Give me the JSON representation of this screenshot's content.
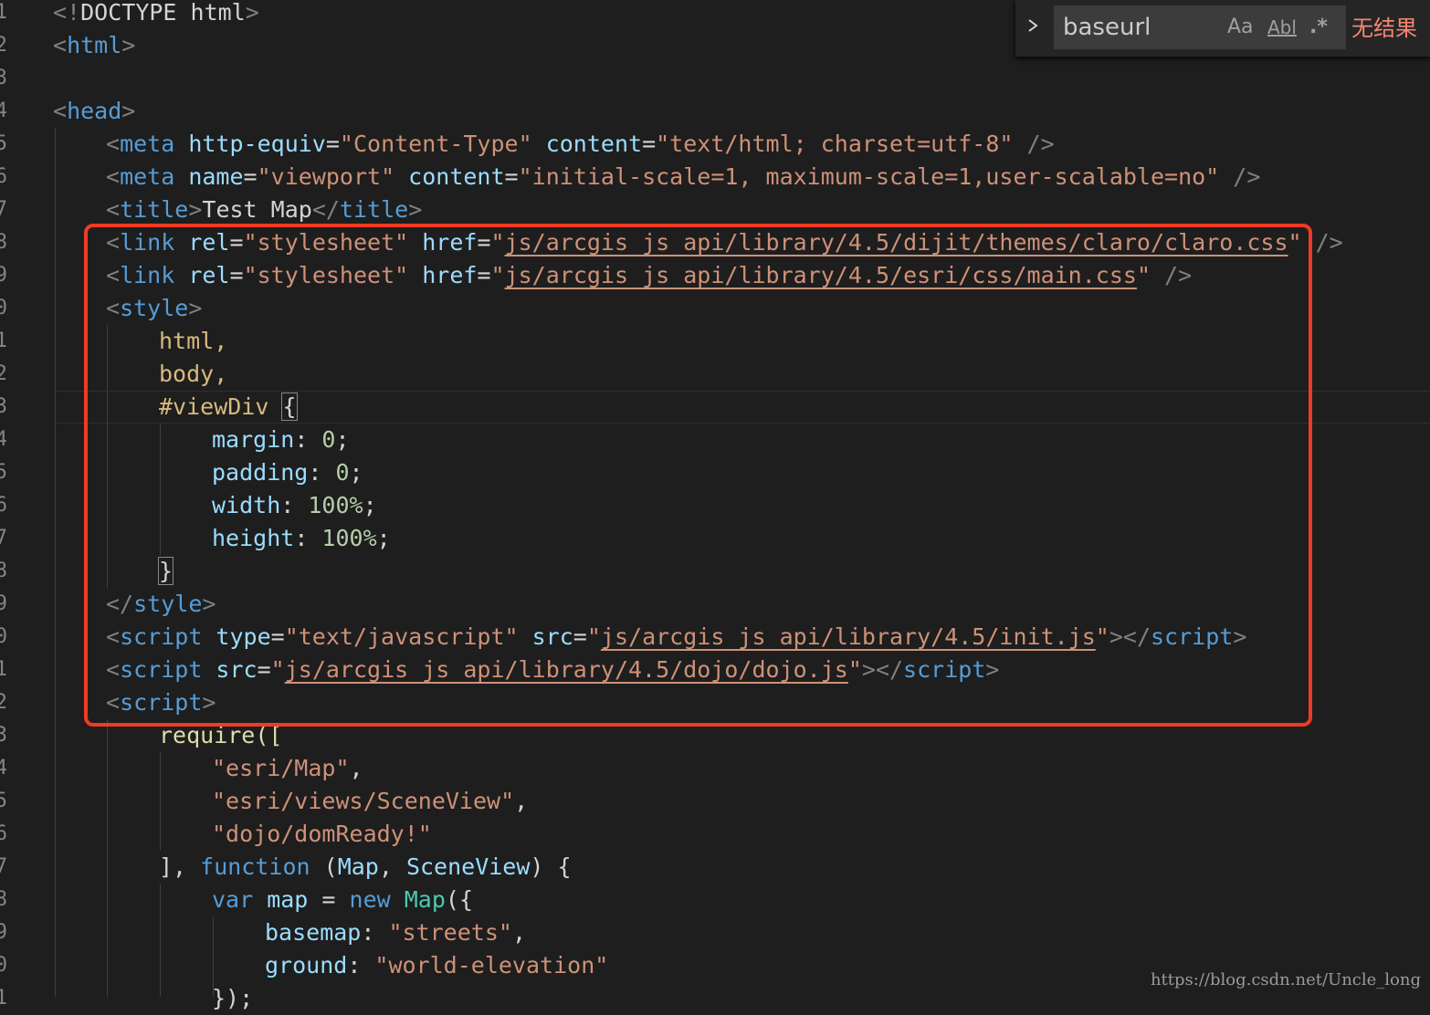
{
  "find_widget": {
    "query": "baseurl",
    "match_case_label": "Aa",
    "whole_word_label": "Abl",
    "regex_label": ".*",
    "result_text": "无结果",
    "toggle_icon": "chevron-right-icon"
  },
  "gutter": {
    "line_numbers": [
      "1",
      "2",
      "3",
      "4",
      "5",
      "6",
      "7",
      "8",
      "9",
      "0",
      "1",
      "2",
      "3",
      "4",
      "5",
      "6",
      "7",
      "8",
      "9",
      "0",
      "1",
      "2",
      "3",
      "4",
      "5",
      "6",
      "7",
      "8",
      "9",
      "0",
      "1"
    ]
  },
  "code": {
    "l1": {
      "a": "<!",
      "b": "DOCTYPE html",
      "c": ">"
    },
    "l2": {
      "a": "<",
      "b": "html",
      "c": ">"
    },
    "l4": {
      "a": "<",
      "b": "head",
      "c": ">"
    },
    "l5": {
      "a": "<",
      "b": "meta",
      "c": " http-equiv",
      "d": "=",
      "e": "\"Content-Type\"",
      "f": " content",
      "g": "=",
      "h": "\"text/html; charset=utf-8\"",
      "i": " />"
    },
    "l6": {
      "a": "<",
      "b": "meta",
      "c": " name",
      "d": "=",
      "e": "\"viewport\"",
      "f": " content",
      "g": "=",
      "h": "\"initial-scale=1, maximum-scale=1,user-scalable=no\"",
      "i": " />"
    },
    "l7": {
      "a": "<",
      "b": "title",
      "c": ">",
      "d": "Test Map",
      "e": "</",
      "f": "title",
      "g": ">"
    },
    "l8": {
      "a": "<",
      "b": "link",
      "c": " rel",
      "d": "=",
      "e": "\"stylesheet\"",
      "f": " href",
      "g": "=",
      "h": "\"",
      "i": "js/arcgis_js_api/library/4.5/dijit/themes/claro/claro.css",
      "j": "\"",
      "k": " />"
    },
    "l9": {
      "a": "<",
      "b": "link",
      "c": " rel",
      "d": "=",
      "e": "\"stylesheet\"",
      "f": " href",
      "g": "=",
      "h": "\"",
      "i": "js/arcgis_js_api/library/4.5/esri/css/main.css",
      "j": "\"",
      "k": " />"
    },
    "l10": {
      "a": "<",
      "b": "style",
      "c": ">"
    },
    "l11": {
      "a": "html,"
    },
    "l12": {
      "a": "body,"
    },
    "l13": {
      "a": "#viewDiv",
      "b": " ",
      "c": "{"
    },
    "l14": {
      "a": "margin",
      "b": ": ",
      "c": "0",
      "d": ";"
    },
    "l15": {
      "a": "padding",
      "b": ": ",
      "c": "0",
      "d": ";"
    },
    "l16": {
      "a": "width",
      "b": ": ",
      "c": "100%",
      "d": ";"
    },
    "l17": {
      "a": "height",
      "b": ": ",
      "c": "100%",
      "d": ";"
    },
    "l18": {
      "a": "}"
    },
    "l19": {
      "a": "</",
      "b": "style",
      "c": ">"
    },
    "l20": {
      "a": "<",
      "b": "script",
      "c": " type",
      "d": "=",
      "e": "\"text/javascript\"",
      "f": " src",
      "g": "=",
      "h": "\"",
      "i": "js/arcgis_js_api/library/4.5/init.js",
      "j": "\"",
      "k": "></",
      "l": "script",
      "m": ">"
    },
    "l21": {
      "a": "<",
      "b": "script",
      "c": " src",
      "d": "=",
      "e": "\"",
      "f": "js/arcgis_js_api/library/4.5/dojo/dojo.js",
      "g": "\"",
      "h": "></",
      "i": "script",
      "j": ">"
    },
    "l22": {
      "a": "<",
      "b": "script",
      "c": ">"
    },
    "l23": {
      "a": "require([",
      "b": ""
    },
    "l24": {
      "a": "\"esri/Map\"",
      "b": ","
    },
    "l25": {
      "a": "\"esri/views/SceneView\"",
      "b": ","
    },
    "l26": {
      "a": "\"dojo/domReady!\""
    },
    "l27": {
      "a": "], ",
      "b": "function",
      "c": " (",
      "d": "Map",
      "e": ", ",
      "f": "SceneView",
      "g": ") {"
    },
    "l28": {
      "a": "var",
      "b": " map ",
      "c": "= ",
      "d": "new",
      "e": " ",
      "f": "Map",
      "g": "({"
    },
    "l29": {
      "a": "basemap",
      "b": ": ",
      "c": "\"streets\"",
      "d": ","
    },
    "l30": {
      "a": "ground",
      "b": ": ",
      "c": "\"world-elevation\""
    },
    "l31": {
      "a": "});"
    }
  },
  "watermark": "https://blog.csdn.net/Uncle_long"
}
